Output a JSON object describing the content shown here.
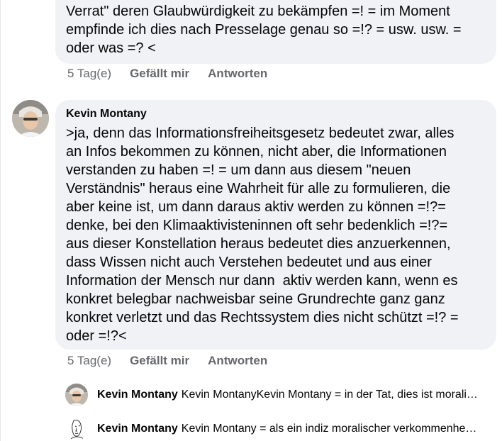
{
  "comments": [
    {
      "text": "Verrat\" deren Glaubwürdigkeit zu bekämpfen =! = im Moment\nempfinde ich dies nach Presselage genau so =!? = usw. usw. =\noder was =? <",
      "time": "5 Tag(e)",
      "like_label": "Gefällt mir",
      "reply_label": "Antworten"
    },
    {
      "author": "Kevin Montany",
      "text": ">ja, denn das Informationsfreiheitsgesetz bedeutet zwar, alles\nan Infos bekommen zu können, nicht aber, die Informationen\nverstanden zu haben =! = um dann aus diesem \"neuen\nVerständnis\" heraus eine Wahrheit für alle zu formulieren, die\naber keine ist, um dann daraus aktiv werden zu können =!?=\ndenke, bei den Klimaaktivisteninnen oft sehr bedenklich =!?=\naus dieser Konstellation heraus bedeutet dies anzuerkennen,\ndass Wissen nicht auch Verstehen bedeutet und aus einer\nInformation der Mensch nur dann  aktiv werden kann, wenn es\nkonkret belegbar nachweisbar seine Grundrechte ganz ganz\nkonkret verletzt und das Rechtssystem dies nicht schützt =!? =\noder =!?<",
      "time": "5 Tag(e)",
      "like_label": "Gefällt mir",
      "reply_label": "Antworten"
    }
  ],
  "replies": [
    {
      "author": "Kevin Montany",
      "text": "Kevin MontanyKevin Montany = in der Tat, dies ist morali…",
      "avatar": "photo-avatar"
    },
    {
      "author": "Kevin Montany",
      "text": "Kevin Montany = als ein indiz moralischer verkommenhe…",
      "avatar": "sketch-avatar"
    }
  ]
}
